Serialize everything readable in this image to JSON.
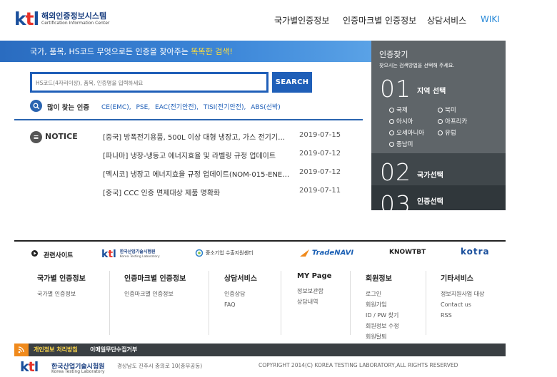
{
  "header": {
    "logo_mark": "ktl",
    "logo_title": "해외인증정보시스템",
    "logo_sub": "Certification Information Center",
    "nav": [
      "국가별인증정보",
      "인증마크별 인증정보",
      "상담서비스",
      "WIKI"
    ]
  },
  "hero": {
    "text_pre": "국가, 품목, HS코드 무엇으로든 인증을 찾아주는 ",
    "text_hl": "똑똑한 검색!"
  },
  "search": {
    "placeholder": "HS코드(4자리이상), 품목, 인증명을 입력하세요",
    "button": "SEARCH",
    "popular_label": "많이 찾는 인증",
    "popular": [
      "CE(EMC),",
      "PSE,",
      "EAC(전기안전),",
      "TISI(전기안전),",
      "ABS(선박)"
    ]
  },
  "notice": {
    "label": "NOTICE",
    "items": [
      {
        "title": "[중국] 방폭전기용품, 500L 이상 대형 냉장고, 가스 전기기기 …",
        "date": "2019-07-15"
      },
      {
        "title": "[파나마] 냉장-냉동고 에너지효율 및 라벨링 규정 업데이트",
        "date": "2019-07-12"
      },
      {
        "title": "[멕시코] 냉장고 에너지효율 규정 업데이트(NOM-015-ENE…",
        "date": "2019-07-12"
      },
      {
        "title": "[중국] CCC 인증 면제대상 제품 명확화",
        "date": "2019-07-11"
      }
    ]
  },
  "side": {
    "title": "인증찾기",
    "subtitle": "찾으시는 검색방법을 선택해 주세요.",
    "step1_num": "01",
    "step1_label": "지역 선택",
    "regions": [
      "국제",
      "북미",
      "아시아",
      "아프리카",
      "오세아니아",
      "유럽",
      "중남미"
    ],
    "step2_num": "02",
    "step2_label": "국가선택",
    "step3_num": "03",
    "step3_label": "인증선택"
  },
  "partners": {
    "label": "관련사이트",
    "items": [
      "한국산업기술시험원",
      "Korea Testing Laboratory",
      "중소기업 수출지원센터",
      "TradeNAVI",
      "KNOWTBT",
      "kotra"
    ]
  },
  "footer_cols": [
    {
      "title": "국가별 인증정보",
      "items": [
        "국가별 인증정보"
      ]
    },
    {
      "title": "인증마크별 인증정보",
      "items": [
        "인증마크별 인증정보"
      ]
    },
    {
      "title": "상담서비스",
      "items": [
        "인증상담",
        "FAQ"
      ]
    },
    {
      "title": "MY Page",
      "items": [
        "정보보관함",
        "상담내역"
      ]
    },
    {
      "title": "회원정보",
      "items": [
        "로그인",
        "회원가입",
        "ID / PW 찾기",
        "회원정보 수정",
        "회원탈퇴"
      ]
    },
    {
      "title": "기타서비스",
      "items": [
        "정보지원사업 대상",
        "Contact us",
        "RSS"
      ]
    }
  ],
  "bottom": {
    "privacy": "개인정보 처리방침",
    "email": "이메일무단수집거부",
    "org_name": "한국산업기술시험원",
    "org_sub": "Korea Testing Laboratory",
    "address": "경상남도 진주시 충의로 10(충무공동)",
    "copyright": "COPYRIGHT 2014(C) KOREA TESTING LABORATORY,ALL RIGHTS RESERVED"
  },
  "colors": {
    "brand_blue": "#1f5fb8",
    "brand_red": "#e8332a",
    "panel_gray": "#5f6569",
    "highlight_yellow": "#ffde3b",
    "rss_orange": "#f08a1c"
  }
}
